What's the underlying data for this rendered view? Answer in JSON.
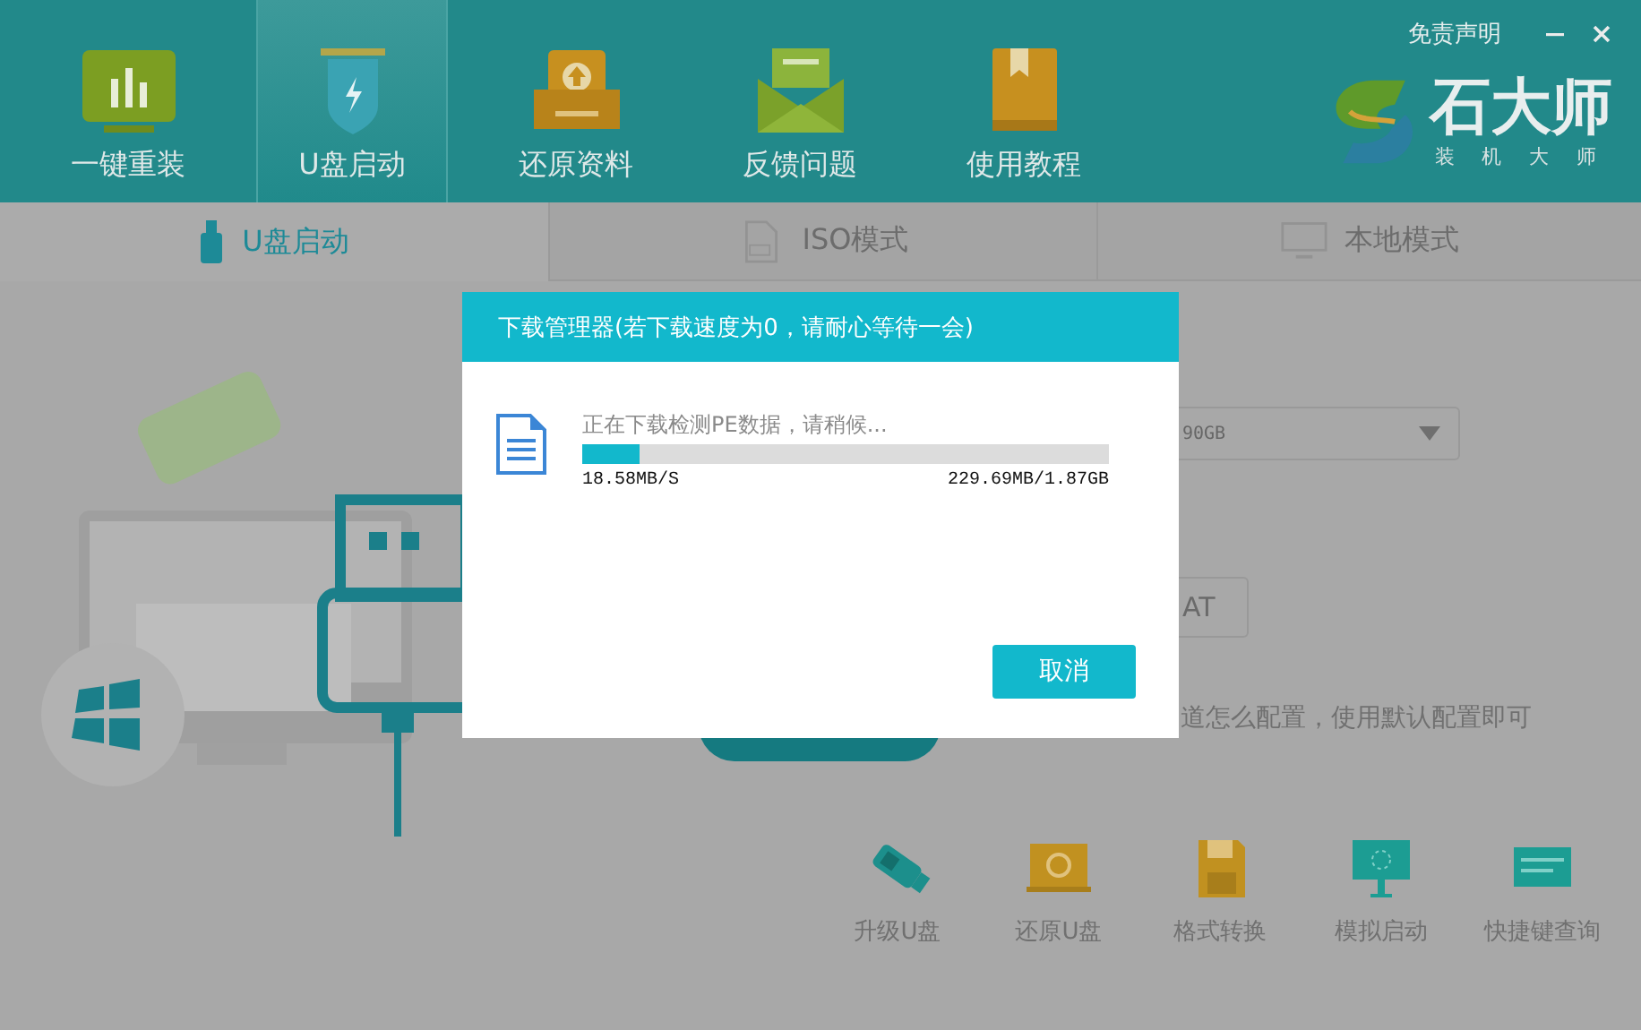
{
  "window": {
    "disclaimer": "免责声明"
  },
  "logo": {
    "name": "石大师",
    "tagline": "装 机 大 师"
  },
  "nav": [
    {
      "label": "一键重装",
      "selected": false
    },
    {
      "label": "U盘启动",
      "selected": true
    },
    {
      "label": "还原资料",
      "selected": false
    },
    {
      "label": "反馈问题",
      "selected": false
    },
    {
      "label": "使用教程",
      "selected": false
    }
  ],
  "mode_tabs": [
    {
      "label": "U盘启动",
      "selected": true
    },
    {
      "label": "ISO模式",
      "selected": false
    },
    {
      "label": "本地模式",
      "selected": false
    }
  ],
  "form": {
    "disk_value": "90GB",
    "format_button": "AT",
    "hint": "道怎么配置，使用默认配置即可"
  },
  "tools": [
    {
      "label": "升级U盘"
    },
    {
      "label": "还原U盘"
    },
    {
      "label": "格式转换"
    },
    {
      "label": "模拟启动"
    },
    {
      "label": "快捷键查询"
    }
  ],
  "dialog": {
    "title": "下载管理器(若下载速度为0，请耐心等待一会)",
    "status": "正在下载检测PE数据，请稍候...",
    "level": 0.11,
    "speed": "18.58MB/S",
    "size": "229.69MB/1.87GB",
    "cancel": "取消"
  }
}
